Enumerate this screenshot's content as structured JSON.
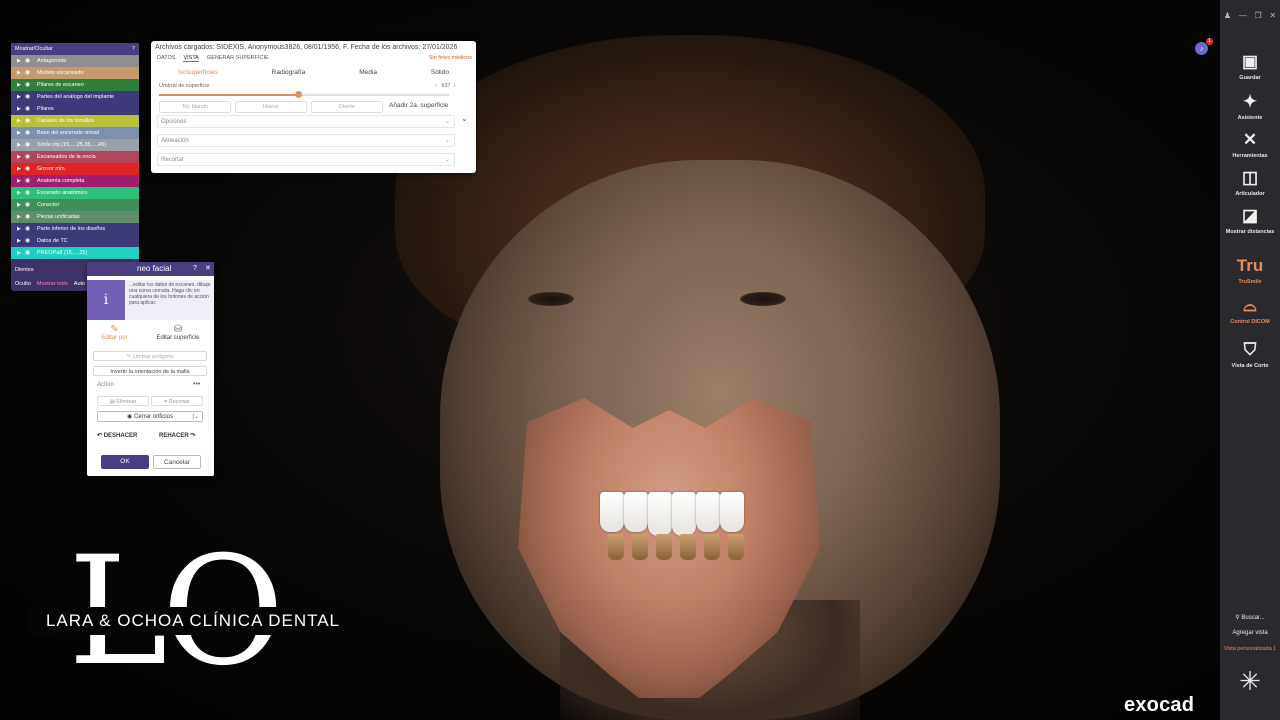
{
  "layers_panel": {
    "title": "Mostrar/Ocultar",
    "help_icon": "help-icon",
    "items": [
      {
        "label": "Antagonista",
        "color": "#8f8f8f"
      },
      {
        "label": "Modelo escaneado",
        "color": "#c79a6e"
      },
      {
        "label": "Pilares de escaneo",
        "color": "#2f7f3a"
      },
      {
        "label": "Partes del análogo del implante",
        "color": "#3d3a7a"
      },
      {
        "label": "Pilares",
        "color": "#3d3a7a"
      },
      {
        "label": "Canales de los tornillos",
        "color": "#b9c13a"
      },
      {
        "label": "Base del encerado virtual",
        "color": "#7f8fb0"
      },
      {
        "label": "Smile.obj (15,...,25,35,...,45)",
        "color": "#9aa0a8"
      },
      {
        "label": "Escaneados de la encía",
        "color": "#b2445c"
      },
      {
        "label": "Grosor mín.",
        "color": "#e02424"
      },
      {
        "label": "Anatomía completa",
        "color": "#a01e6e"
      },
      {
        "label": "Encerado anatómico",
        "color": "#2fbf7a"
      },
      {
        "label": "Conector",
        "color": "#3f8f5a"
      },
      {
        "label": "Piezas unificadas",
        "color": "#5f8f6a"
      },
      {
        "label": "Parte inferior de los diseños",
        "color": "#3d3a7a"
      },
      {
        "label": "Datos de TC",
        "color": "#3d3a7a"
      },
      {
        "label": "PREOPa8 (15,...,25)",
        "color": "#1fcfbf"
      }
    ],
    "footer": {
      "teeth_label": "Dientes",
      "hidden_label": "Oculto",
      "show_all_label": "Mostrar todo",
      "auto_hide_label": "Auto Ocultar"
    }
  },
  "top_dialog": {
    "title": "Archivos cargados: SIDEXIS, Anonymous3826, 08/01/1956, F. Fecha de los archivos: 27/01/2026",
    "tabs": [
      "DATOS",
      "VISTA",
      "GENERAR SUPERFICIE"
    ],
    "active_tab": "VISTA",
    "right_link": "Sin fines médicos",
    "subtabs": [
      "Isosuperficies",
      "Radiografía",
      "Media",
      "Sólido"
    ],
    "active_subtab": "Isosuperficies",
    "threshold_label": "Umbral de superficie",
    "threshold_value": "937",
    "threshold_fraction": 0.48,
    "buttons": [
      "Tej. blando",
      "Hueso",
      "Diente"
    ],
    "add_surface": "Añadir 2a. superficie",
    "dropdowns": [
      "Opciones",
      "Alineación",
      "Recortar"
    ]
  },
  "face_panel": {
    "title": "neo facial",
    "info_text": "...editar los datos de escaneo, dibuje una curva cerrada. Haga clic en cualquiera de los botones de acción para aplicar.",
    "modes": [
      {
        "label": "Editar por",
        "icon": "edit-by-icon"
      },
      {
        "label": "Editar superficie",
        "icon": "edit-surface-icon"
      }
    ],
    "active_mode": "Editar por",
    "clear_polygon": "Limpiar polígono",
    "invert_mesh": "Invertir la orientación de la malla",
    "action_label": "Action",
    "delete_label": "Eliminar",
    "crop_label": "Recortar",
    "close_holes": "Cerrar orificios",
    "undo_label": "DESHACER",
    "redo_label": "REHACER",
    "ok_label": "OK",
    "cancel_label": "Cancelar"
  },
  "toolbar": {
    "items": [
      {
        "label": "Guardar",
        "icon": "save-icon",
        "glyph": "▣"
      },
      {
        "label": "Asistente",
        "icon": "wizard-icon",
        "glyph": "✦"
      },
      {
        "label": "Herramientas",
        "icon": "tools-icon",
        "glyph": "✕"
      },
      {
        "label": "Articulador",
        "icon": "articulator-icon",
        "glyph": "◫"
      },
      {
        "label": "Mostrar distancias",
        "icon": "distances-icon",
        "glyph": "◪"
      },
      {
        "label": "TruSmile",
        "icon": "trusmile-icon",
        "glyph": "Tru"
      },
      {
        "label": "Control DICOM",
        "icon": "dicom-icon",
        "glyph": "⌓"
      },
      {
        "label": "Vista de Corte",
        "icon": "section-view-icon",
        "glyph": "⛉"
      }
    ],
    "search_label": "Buscar...",
    "add_view": "Agregar vista",
    "custom_view": "Vista personalizada 1"
  },
  "notifications": {
    "count": "1"
  },
  "logo": {
    "mark": "LO",
    "text": "LARA & OCHOA CLÍNICA DENTAL"
  },
  "brand": {
    "name": "exocad"
  },
  "colors": {
    "accent": "#e58b5a",
    "panel_purple": "#4a3d80",
    "toolbar": "#2a2a2e"
  }
}
